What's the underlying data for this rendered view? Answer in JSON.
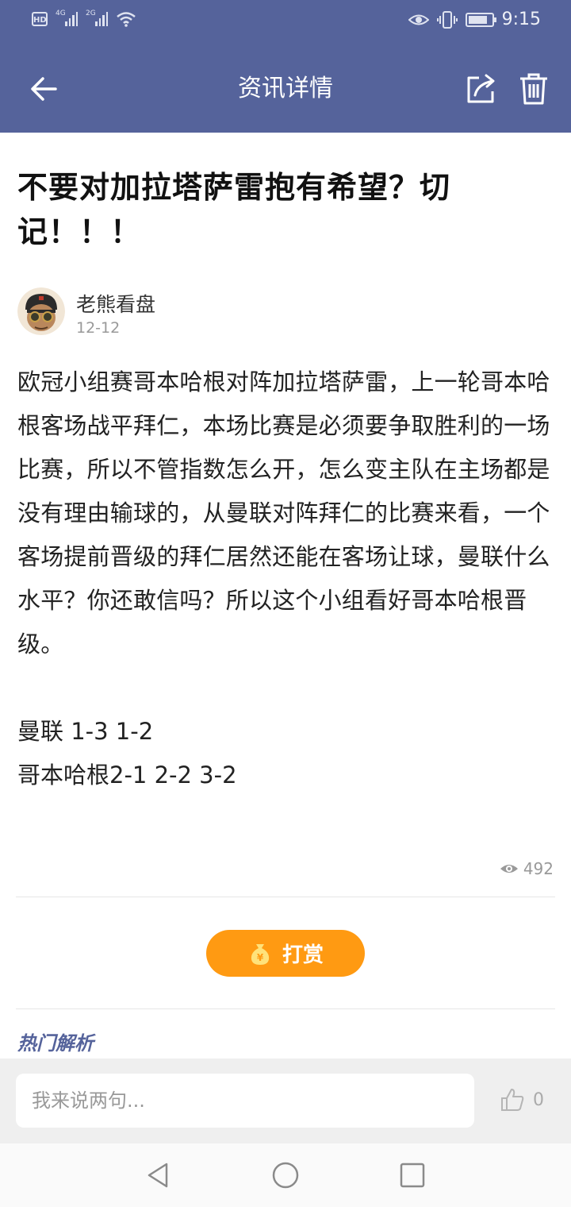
{
  "status_bar": {
    "time": "9:15",
    "hd_label": "HD",
    "sim1_gen": "4G",
    "sim2_gen": "2G",
    "battery_level": 0.85
  },
  "header": {
    "title": "资讯详情",
    "back_icon": "arrow-left-icon",
    "share_icon": "share-icon",
    "delete_icon": "trash-icon"
  },
  "article": {
    "title": "不要对加拉塔萨雷抱有希望？切记！！！",
    "author": {
      "name": "老熊看盘",
      "date": "12-12"
    },
    "body": "欧冠小组赛哥本哈根对阵加拉塔萨雷，上一轮哥本哈根客场战平拜仁，本场比赛是必须要争取胜利的一场比赛，所以不管指数怎么开，怎么变主队在主场都是没有理由输球的，从曼联对阵拜仁的比赛来看，一个客场提前晋级的拜仁居然还能在客场让球，曼联什么水平？你还敢信吗？所以这个小组看好哥本哈根晋级。",
    "odds": [
      "曼联 1-3 1-2",
      "哥本哈根2-1 2-2 3-2"
    ],
    "views": "492"
  },
  "reward": {
    "label": "打赏",
    "icon": "money-bag-icon"
  },
  "hot_section": {
    "label": "热门解析"
  },
  "comment_bar": {
    "placeholder": "我来说两句...",
    "likes": "0"
  },
  "colors": {
    "primary": "#55639b",
    "accent": "#ff9a12"
  }
}
